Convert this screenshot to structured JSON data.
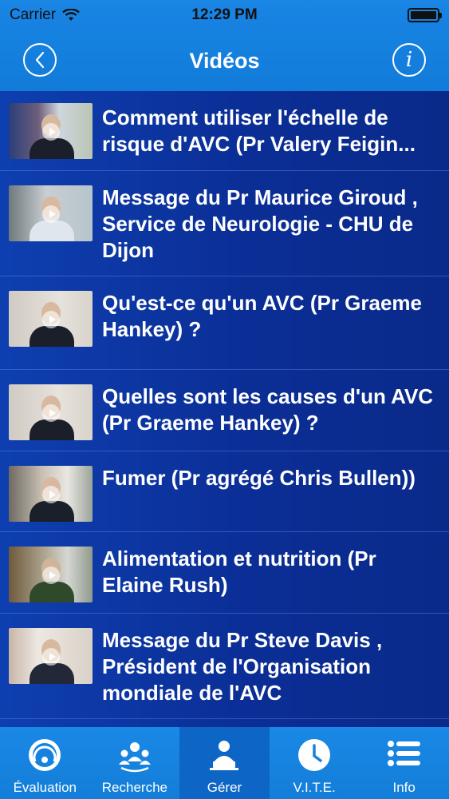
{
  "status": {
    "carrier": "Carrier",
    "time": "12:29 PM",
    "battery_percent": 100
  },
  "nav": {
    "title": "Vidéos",
    "back_icon": "chevron-left-icon",
    "info_icon": "info-icon"
  },
  "videos": [
    {
      "title": "Comment utiliser l'échelle de risque d'AVC (Pr Valery Feigin..."
    },
    {
      "title": "Message du Pr Maurice Giroud , Service de Neurologie - CHU de Dijon"
    },
    {
      "title": "Qu'est-ce qu'un AVC (Pr Graeme Hankey) ?"
    },
    {
      "title": "Quelles sont les causes d'un AVC (Pr Graeme Hankey) ?"
    },
    {
      "title": "Fumer (Pr agrégé Chris Bullen))"
    },
    {
      "title": "Alimentation et nutrition (Pr Elaine Rush)"
    },
    {
      "title": "Message du Pr Steve Davis , Président de l'Organisation mondiale de l'AVC"
    }
  ],
  "tabs": [
    {
      "label": "Évaluation",
      "icon": "gauge-icon",
      "active": false
    },
    {
      "label": "Recherche",
      "icon": "people-icon",
      "active": false
    },
    {
      "label": "Gérer",
      "icon": "person-computer-icon",
      "active": true
    },
    {
      "label": "V.I.T.E.",
      "icon": "clock-icon",
      "active": false
    },
    {
      "label": "Info",
      "icon": "list-icon",
      "active": false
    }
  ],
  "colors": {
    "accent": "#1682e0",
    "list_bg": "#0b2f9e",
    "active_tab": "#0d66c6"
  }
}
